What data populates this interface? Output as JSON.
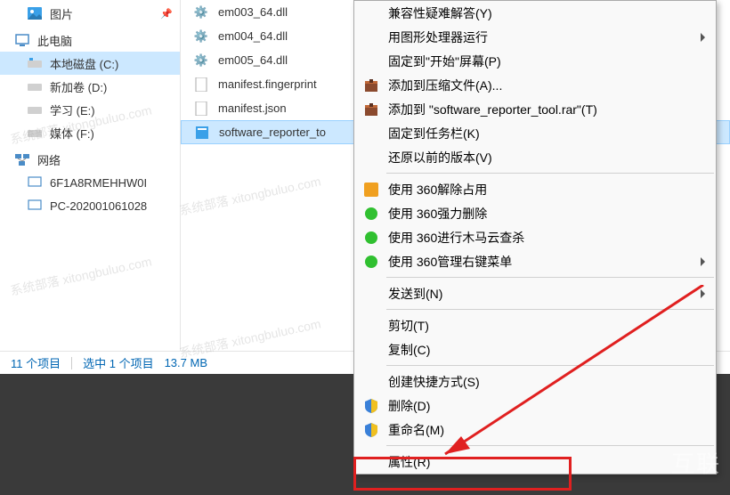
{
  "nav": {
    "pictures": "图片",
    "thispc": "此电脑",
    "drive_c": "本地磁盘 (C:)",
    "drive_d": "新加卷 (D:)",
    "drive_e": "学习 (E:)",
    "drive_f": "媒体 (F:)",
    "network": "网络",
    "net1": "6F1A8RMEHHW0I",
    "net2": "PC-202001061028"
  },
  "files": {
    "f1": "em003_64.dll",
    "f2": "em004_64.dll",
    "f3": "em005_64.dll",
    "f4": "manifest.fingerprint",
    "f5": "manifest.json",
    "f6": "software_reporter_to"
  },
  "status": {
    "count": "11 个项目",
    "selected": "选中 1 个项目",
    "size": "13.7 MB"
  },
  "menu": {
    "compat": "兼容性疑难解答(Y)",
    "gpu": "用图形处理器运行",
    "pinstart": "固定到\"开始\"屏幕(P)",
    "rar_add": "添加到压缩文件(A)...",
    "rar_add2": "添加到 \"software_reporter_tool.rar\"(T)",
    "pintask": "固定到任务栏(K)",
    "restore": "还原以前的版本(V)",
    "use360_release": "使用 360解除占用",
    "use360_forcedel": "使用 360强力删除",
    "use360_trojan": "使用 360进行木马云查杀",
    "use360_menumgr": "使用 360管理右键菜单",
    "sendto": "发送到(N)",
    "cut": "剪切(T)",
    "copy": "复制(C)",
    "shortcut": "创建快捷方式(S)",
    "delete": "删除(D)",
    "rename": "重命名(M)",
    "properties": "属性(R)"
  },
  "watermark": "系统部落 xitongbuluo.com",
  "logo": "互联"
}
